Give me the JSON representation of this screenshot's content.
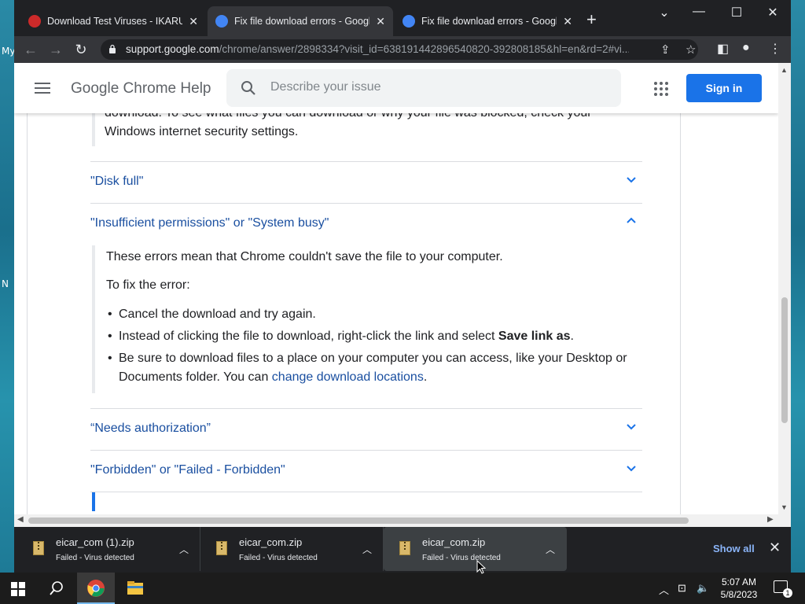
{
  "desktop": {
    "labels": [
      "My",
      "N"
    ]
  },
  "tabs": [
    {
      "title": "Download Test Viruses - IKARUS",
      "favicon_color": "#cc2a2a"
    },
    {
      "title": "Fix file download errors - Google",
      "favicon_color": "#4285f4"
    },
    {
      "title": "Fix file download errors - Google",
      "favicon_color": "#4285f4"
    }
  ],
  "address_bar": {
    "host": "support.google.com",
    "path": "/chrome/answer/2898334?visit_id=638191442896540820-392808185&hl=en&rd=2#vi..."
  },
  "page_header": {
    "brand": "Google Chrome Help",
    "search_placeholder": "Describe your issue",
    "sign_in": "Sign in"
  },
  "content": {
    "prev_text_partial": "download. To see what files you can download or why your file was blocked, check your",
    "prev_text_line2": "Windows internet security settings.",
    "sections": [
      {
        "label": "\"Disk full\"",
        "expanded": false
      },
      {
        "label": "\"Insufficient permissions\" or \"System busy\"",
        "expanded": true
      },
      {
        "label": "“Needs authorization”",
        "expanded": false
      },
      {
        "label": "\"Forbidden\" or \"Failed - Forbidden\"",
        "expanded": false
      }
    ],
    "expanded_body": {
      "intro": "These errors mean that Chrome couldn't save the file to your computer.",
      "fix_heading": "To fix the error:",
      "bullet1": "Cancel the download and try again.",
      "bullet2_pre": "Instead of clicking the file to download, right-click the link and select ",
      "bullet2_bold": "Save link as",
      "bullet2_post": ".",
      "bullet3_pre": "Be sure to download files to a place on your computer you can access, like your Desktop or Documents folder. You can ",
      "bullet3_link": "change download locations",
      "bullet3_post": "."
    }
  },
  "downloads": [
    {
      "name": "eicar_com (1).zip",
      "status": "Failed - Virus detected"
    },
    {
      "name": "eicar_com.zip",
      "status": "Failed - Virus detected"
    },
    {
      "name": "eicar_com.zip",
      "status": "Failed - Virus detected"
    }
  ],
  "download_shelf": {
    "show_all": "Show all"
  },
  "taskbar": {
    "time": "5:07 AM",
    "date": "5/8/2023"
  },
  "colors": {
    "link": "#1a4fa0",
    "accent": "#1a73e8",
    "dark": "#202124"
  }
}
